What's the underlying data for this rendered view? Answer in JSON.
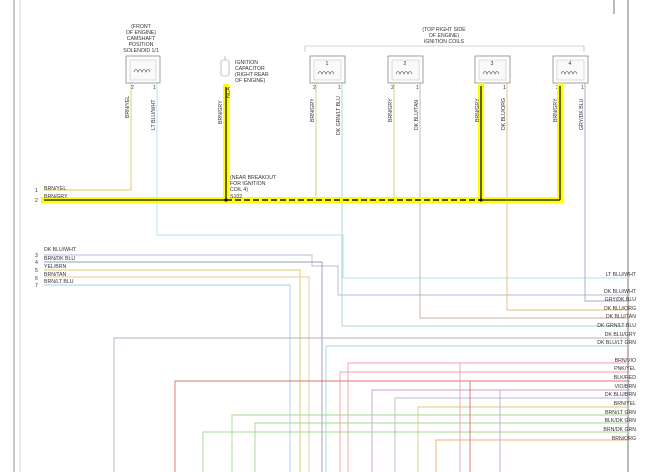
{
  "colors": {
    "highlight": "#ffff00",
    "ltblu_wht": "#aee4ee",
    "dkblu_wht": "#b8b8d8",
    "brn_dkblu": "#9a9ab8",
    "yel_brn": "#d8cc60",
    "brn_tan": "#e8c898",
    "brn_ltblu": "#9cd4e4",
    "dkblu_gry": "#b0b0c4",
    "dkgrn_ltblu": "#a4d8c8",
    "dkblu_tan": "#c8b0a0",
    "dkblu_org": "#e8b880",
    "gry_dkblu": "#9aaccc",
    "brn_yel": "#d4cc78",
    "pink": "#f4a0a8",
    "red": "#e07070",
    "violet": "#c8a0d8",
    "green": "#a4d890",
    "orange": "#f0b070"
  },
  "components": {
    "cam_solenoid": {
      "label": [
        "(FRONT",
        "OF ENGINE)",
        "CAMSHAFT",
        "POSITION",
        "SOLENOID 1/1"
      ],
      "pins": [
        "2",
        "1"
      ]
    },
    "ignition_capacitor": {
      "label": [
        "IGNITION",
        "CAPACITOR",
        "(RIGHT REAR",
        "OF ENGINE)"
      ]
    },
    "coils_header": [
      "(TOP RIGHT SIDE",
      "OF ENGINE)",
      "IGNITION COILS"
    ],
    "coils": [
      {
        "number": "1",
        "pins": [
          "2",
          "1"
        ]
      },
      {
        "number": "2",
        "pins": [
          "2",
          "1"
        ]
      },
      {
        "number": "3",
        "pins": [
          "2",
          "1"
        ]
      },
      {
        "number": "4",
        "pins": [
          "2",
          "1"
        ]
      }
    ],
    "breakout_note": [
      "(NEAR BREAKOUT",
      "FOR IGNITION",
      "COIL 4)"
    ],
    "splice_label": "S102"
  },
  "vertical_wire_labels": {
    "cam1": "BRN/YEL",
    "cam2": "LT BLU/WHT",
    "cap": "BRN/GRY",
    "cap_top": "NCA",
    "coil1_a": "BRN/GRY",
    "coil1_b": "DK GRN/LT BLU",
    "coil2_a": "BRN/GRY",
    "coil2_b": "DK BLU/TAN",
    "coil3_a": "BRN/GRY",
    "coil3_b": "DK BLU/ORG",
    "coil4_a": "BRN/GRY",
    "coil4_b": "GRY/DK BLU"
  },
  "left_rows": [
    {
      "num": "1",
      "wire": "BRN/YEL"
    },
    {
      "num": "2",
      "wire": "BRN/GRY"
    },
    {
      "num": "3",
      "wire": "DK BLU/WHT"
    },
    {
      "num": "4",
      "wire": "BRN/DK BLU"
    },
    {
      "num": "5",
      "wire": "YEL/BRN"
    },
    {
      "num": "6",
      "wire": "BRN/TAN"
    },
    {
      "num": "7",
      "wire": "BRN/LT BLU"
    }
  ],
  "right_labels": [
    "LT BLU/WHT",
    "DK BLU/WHT",
    "GRY/DK BLU",
    "DK BLU/ORG",
    "DK BLU/TAN",
    "DK GRN/LT BLU",
    "DK BLU/GRY",
    "DK BLU/LT GRN",
    "BRN/VIO",
    "PNK/YEL",
    "BLK/RED",
    "VIO/BRN",
    "DK BLU/BRN",
    "BRN/YEL",
    "BRN/LT GRN",
    "BLK/DK GRN",
    "BRN/DK GRN",
    "BRN/ORG"
  ]
}
